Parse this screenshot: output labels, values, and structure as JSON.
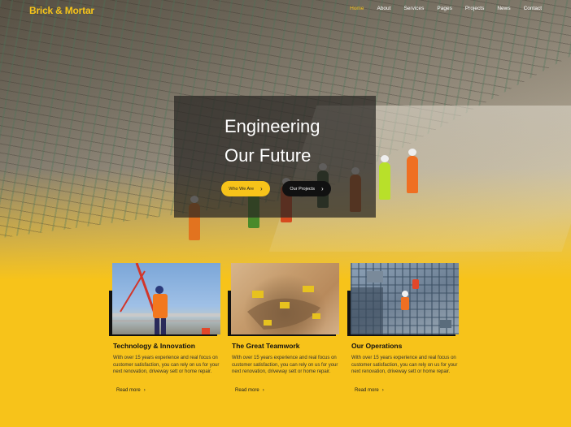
{
  "brand": {
    "name": "Brick & Mortar",
    "color": "#f7c31a"
  },
  "nav": {
    "items": [
      {
        "label": "Home",
        "active": true
      },
      {
        "label": "About",
        "active": false
      },
      {
        "label": "Services",
        "active": false
      },
      {
        "label": "Pages",
        "active": false
      },
      {
        "label": "Projects",
        "active": false
      },
      {
        "label": "News",
        "active": false
      },
      {
        "label": "Contact",
        "active": false
      }
    ]
  },
  "hero": {
    "title_line1": "Engineering",
    "title_line2": "Our Future",
    "primary_button": "Who We Are",
    "secondary_button": "Our Projects",
    "button_icon": "chevron-right-icon"
  },
  "cards": [
    {
      "title": "Technology & Innovation",
      "text": "With over 15 years experience and real focus on customer satisfaction, you can rely on us for your next renovation, driveway sett or home repair.",
      "link": "Read more"
    },
    {
      "title": "The Great Teamwork",
      "text": "With over 15 years experience and real focus on customer satisfaction, you can rely on us for your next renovation, driveway sett or home repair.",
      "link": "Read more"
    },
    {
      "title": "Our Operations",
      "text": "With over 15 years experience and real focus on customer satisfaction, you can rely on us for your next renovation, driveway sett or home repair.",
      "link": "Read more"
    }
  ],
  "colors": {
    "accent": "#f7c31a",
    "dark": "#111111"
  }
}
